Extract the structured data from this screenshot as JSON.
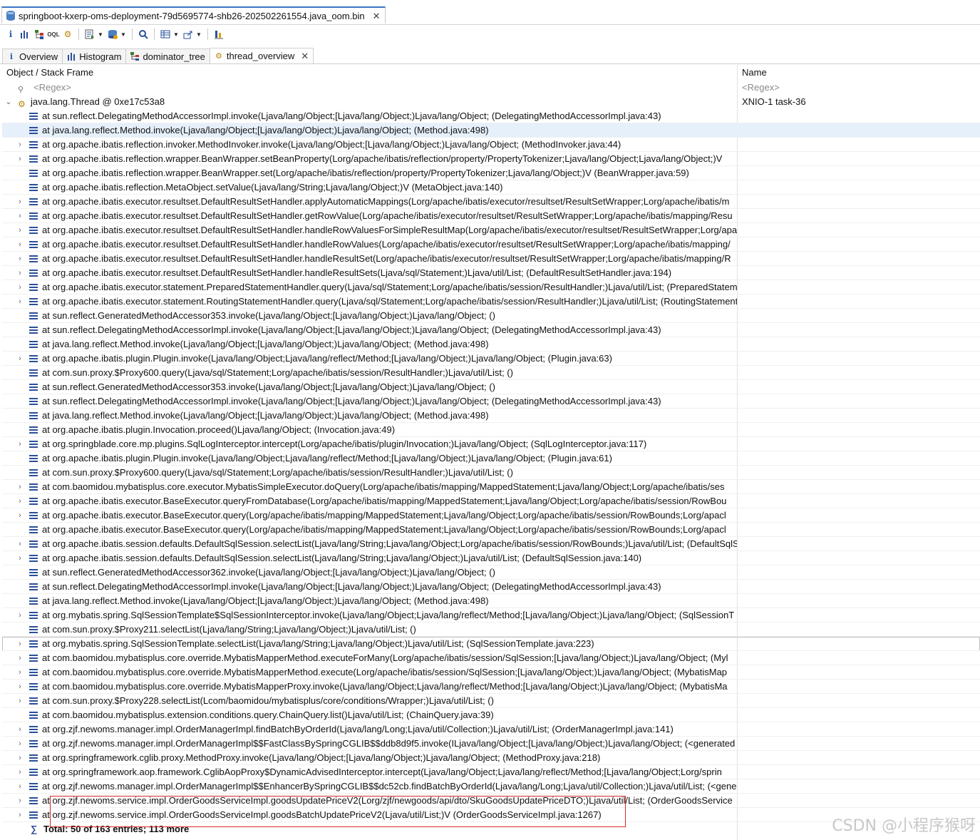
{
  "editor_tab": {
    "title": "springboot-kxerp-oms-deployment-79d5695774-shb26-202502261554.java_oom.bin"
  },
  "toolbar": {
    "items": [
      "info-icon",
      "histogram-icon",
      "dominator-tree-icon",
      "oql-icon",
      "thread-overview-icon",
      "run-report-icon",
      "query-browser-icon",
      "search-icon",
      "group-result-icon",
      "export-icon",
      "calculate-retained-icon"
    ]
  },
  "view_tabs": [
    {
      "label": "Overview",
      "icon": "info-icon",
      "active": false
    },
    {
      "label": "Histogram",
      "icon": "histogram-icon",
      "active": false
    },
    {
      "label": "dominator_tree",
      "icon": "dominator-tree-icon",
      "active": false
    },
    {
      "label": "thread_overview",
      "icon": "thread-overview-icon",
      "active": true
    }
  ],
  "table": {
    "columns": [
      "Object / Stack Frame",
      "Name"
    ],
    "regex_placeholder": "<Regex>",
    "thread": {
      "label": "java.lang.Thread @ 0xe17c53a8",
      "name": "XNIO-1 task-36"
    },
    "frames": [
      "at sun.reflect.DelegatingMethodAccessorImpl.invoke(Ljava/lang/Object;[Ljava/lang/Object;)Ljava/lang/Object; (DelegatingMethodAccessorImpl.java:43)",
      "at java.lang.reflect.Method.invoke(Ljava/lang/Object;[Ljava/lang/Object;)Ljava/lang/Object; (Method.java:498)",
      "at org.apache.ibatis.reflection.invoker.MethodInvoker.invoke(Ljava/lang/Object;[Ljava/lang/Object;)Ljava/lang/Object; (MethodInvoker.java:44)",
      "at org.apache.ibatis.reflection.wrapper.BeanWrapper.setBeanProperty(Lorg/apache/ibatis/reflection/property/PropertyTokenizer;Ljava/lang/Object;Ljava/lang/Object;)V",
      "at org.apache.ibatis.reflection.wrapper.BeanWrapper.set(Lorg/apache/ibatis/reflection/property/PropertyTokenizer;Ljava/lang/Object;)V (BeanWrapper.java:59)",
      "at org.apache.ibatis.reflection.MetaObject.setValue(Ljava/lang/String;Ljava/lang/Object;)V (MetaObject.java:140)",
      "at org.apache.ibatis.executor.resultset.DefaultResultSetHandler.applyAutomaticMappings(Lorg/apache/ibatis/executor/resultset/ResultSetWrapper;Lorg/apache/ibatis/m",
      "at org.apache.ibatis.executor.resultset.DefaultResultSetHandler.getRowValue(Lorg/apache/ibatis/executor/resultset/ResultSetWrapper;Lorg/apache/ibatis/mapping/Resu",
      "at org.apache.ibatis.executor.resultset.DefaultResultSetHandler.handleRowValuesForSimpleResultMap(Lorg/apache/ibatis/executor/resultset/ResultSetWrapper;Lorg/apa",
      "at org.apache.ibatis.executor.resultset.DefaultResultSetHandler.handleRowValues(Lorg/apache/ibatis/executor/resultset/ResultSetWrapper;Lorg/apache/ibatis/mapping/",
      "at org.apache.ibatis.executor.resultset.DefaultResultSetHandler.handleResultSet(Lorg/apache/ibatis/executor/resultset/ResultSetWrapper;Lorg/apache/ibatis/mapping/R",
      "at org.apache.ibatis.executor.resultset.DefaultResultSetHandler.handleResultSets(Ljava/sql/Statement;)Ljava/util/List; (DefaultResultSetHandler.java:194)",
      "at org.apache.ibatis.executor.statement.PreparedStatementHandler.query(Ljava/sql/Statement;Lorg/apache/ibatis/session/ResultHandler;)Ljava/util/List; (PreparedStatem",
      "at org.apache.ibatis.executor.statement.RoutingStatementHandler.query(Ljava/sql/Statement;Lorg/apache/ibatis/session/ResultHandler;)Ljava/util/List; (RoutingStatement",
      "at sun.reflect.GeneratedMethodAccessor353.invoke(Ljava/lang/Object;[Ljava/lang/Object;)Ljava/lang/Object; ()",
      "at sun.reflect.DelegatingMethodAccessorImpl.invoke(Ljava/lang/Object;[Ljava/lang/Object;)Ljava/lang/Object; (DelegatingMethodAccessorImpl.java:43)",
      "at java.lang.reflect.Method.invoke(Ljava/lang/Object;[Ljava/lang/Object;)Ljava/lang/Object; (Method.java:498)",
      "at org.apache.ibatis.plugin.Plugin.invoke(Ljava/lang/Object;Ljava/lang/reflect/Method;[Ljava/lang/Object;)Ljava/lang/Object; (Plugin.java:63)",
      "at com.sun.proxy.$Proxy600.query(Ljava/sql/Statement;Lorg/apache/ibatis/session/ResultHandler;)Ljava/util/List; ()",
      "at sun.reflect.GeneratedMethodAccessor353.invoke(Ljava/lang/Object;[Ljava/lang/Object;)Ljava/lang/Object; ()",
      "at sun.reflect.DelegatingMethodAccessorImpl.invoke(Ljava/lang/Object;[Ljava/lang/Object;)Ljava/lang/Object; (DelegatingMethodAccessorImpl.java:43)",
      "at java.lang.reflect.Method.invoke(Ljava/lang/Object;[Ljava/lang/Object;)Ljava/lang/Object; (Method.java:498)",
      "at org.apache.ibatis.plugin.Invocation.proceed()Ljava/lang/Object; (Invocation.java:49)",
      "at org.springblade.core.mp.plugins.SqlLogInterceptor.intercept(Lorg/apache/ibatis/plugin/Invocation;)Ljava/lang/Object; (SqlLogInterceptor.java:117)",
      "at org.apache.ibatis.plugin.Plugin.invoke(Ljava/lang/Object;Ljava/lang/reflect/Method;[Ljava/lang/Object;)Ljava/lang/Object; (Plugin.java:61)",
      "at com.sun.proxy.$Proxy600.query(Ljava/sql/Statement;Lorg/apache/ibatis/session/ResultHandler;)Ljava/util/List; ()",
      "at com.baomidou.mybatisplus.core.executor.MybatisSimpleExecutor.doQuery(Lorg/apache/ibatis/mapping/MappedStatement;Ljava/lang/Object;Lorg/apache/ibatis/ses",
      "at org.apache.ibatis.executor.BaseExecutor.queryFromDatabase(Lorg/apache/ibatis/mapping/MappedStatement;Ljava/lang/Object;Lorg/apache/ibatis/session/RowBou",
      "at org.apache.ibatis.executor.BaseExecutor.query(Lorg/apache/ibatis/mapping/MappedStatement;Ljava/lang/Object;Lorg/apache/ibatis/session/RowBounds;Lorg/apacl",
      "at org.apache.ibatis.executor.BaseExecutor.query(Lorg/apache/ibatis/mapping/MappedStatement;Ljava/lang/Object;Lorg/apache/ibatis/session/RowBounds;Lorg/apacl",
      "at org.apache.ibatis.session.defaults.DefaultSqlSession.selectList(Ljava/lang/String;Ljava/lang/Object;Lorg/apache/ibatis/session/RowBounds;)Ljava/util/List; (DefaultSqlSe",
      "at org.apache.ibatis.session.defaults.DefaultSqlSession.selectList(Ljava/lang/String;Ljava/lang/Object;)Ljava/util/List; (DefaultSqlSession.java:140)",
      "at sun.reflect.GeneratedMethodAccessor362.invoke(Ljava/lang/Object;[Ljava/lang/Object;)Ljava/lang/Object; ()",
      "at sun.reflect.DelegatingMethodAccessorImpl.invoke(Ljava/lang/Object;[Ljava/lang/Object;)Ljava/lang/Object; (DelegatingMethodAccessorImpl.java:43)",
      "at java.lang.reflect.Method.invoke(Ljava/lang/Object;[Ljava/lang/Object;)Ljava/lang/Object; (Method.java:498)",
      "at org.mybatis.spring.SqlSessionTemplate$SqlSessionInterceptor.invoke(Ljava/lang/Object;Ljava/lang/reflect/Method;[Ljava/lang/Object;)Ljava/lang/Object; (SqlSessionT",
      "at com.sun.proxy.$Proxy211.selectList(Ljava/lang/String;Ljava/lang/Object;)Ljava/util/List; ()",
      "at org.mybatis.spring.SqlSessionTemplate.selectList(Ljava/lang/String;Ljava/lang/Object;)Ljava/util/List; (SqlSessionTemplate.java:223)",
      "at com.baomidou.mybatisplus.core.override.MybatisMapperMethod.executeForMany(Lorg/apache/ibatis/session/SqlSession;[Ljava/lang/Object;)Ljava/lang/Object; (Myl",
      "at com.baomidou.mybatisplus.core.override.MybatisMapperMethod.execute(Lorg/apache/ibatis/session/SqlSession;[Ljava/lang/Object;)Ljava/lang/Object; (MybatisMap",
      "at com.baomidou.mybatisplus.core.override.MybatisMapperProxy.invoke(Ljava/lang/Object;Ljava/lang/reflect/Method;[Ljava/lang/Object;)Ljava/lang/Object; (MybatisMa",
      "at com.sun.proxy.$Proxy228.selectList(Lcom/baomidou/mybatisplus/core/conditions/Wrapper;)Ljava/util/List; ()",
      "at com.baomidou.mybatisplus.extension.conditions.query.ChainQuery.list()Ljava/util/List; (ChainQuery.java:39)",
      "at org.zjf.newoms.manager.impl.OrderManagerImpl.findBatchByOrderId(Ljava/lang/Long;Ljava/util/Collection;)Ljava/util/List; (OrderManagerImpl.java:141)",
      "at org.zjf.newoms.manager.impl.OrderManagerImpl$$FastClassBySpringCGLIB$$ddb8d9f5.invoke(ILjava/lang/Object;[Ljava/lang/Object;)Ljava/lang/Object; (<generated",
      "at org.springframework.cglib.proxy.MethodProxy.invoke(Ljava/lang/Object;[Ljava/lang/Object;)Ljava/lang/Object; (MethodProxy.java:218)",
      "at org.springframework.aop.framework.CglibAopProxy$DynamicAdvisedInterceptor.intercept(Ljava/lang/Object;Ljava/lang/reflect/Method;[Ljava/lang/Object;Lorg/sprin",
      "at org.zjf.newoms.manager.impl.OrderManagerImpl$$EnhancerBySpringCGLIB$$dc52cb.findBatchByOrderId(Ljava/lang/Long;Ljava/util/Collection;)Ljava/util/List; (<gene",
      "at org.zjf.newoms.service.impl.OrderGoodsServiceImpl.goodsUpdatePriceV2(Lorg/zjf/newgoods/api/dto/SkuGoodsUpdatePriceDTO;)Ljava/util/List; (OrderGoodsService",
      "at org.zjf.newoms.service.impl.OrderGoodsServiceImpl.goodsBatchUpdatePriceV2(Ljava/util/List;)V (OrderGoodsServiceImpl.java:1267)"
    ],
    "expandable": [
      false,
      false,
      true,
      true,
      false,
      false,
      true,
      true,
      true,
      true,
      true,
      true,
      true,
      true,
      false,
      false,
      false,
      true,
      false,
      false,
      false,
      false,
      false,
      true,
      false,
      false,
      true,
      true,
      true,
      false,
      true,
      true,
      false,
      false,
      false,
      true,
      false,
      true,
      true,
      true,
      true,
      true,
      false,
      true,
      true,
      true,
      true,
      true,
      true,
      true
    ],
    "selected_index": 1,
    "boxed_index": 37,
    "total": "Total: 50 of 163 entries; 113 more"
  },
  "watermark": "CSDN @小程序猴呀",
  "colors": {
    "accent": "#3a74c5",
    "selection": "#e6f0fb",
    "highlight_box": "#d42a2a"
  }
}
